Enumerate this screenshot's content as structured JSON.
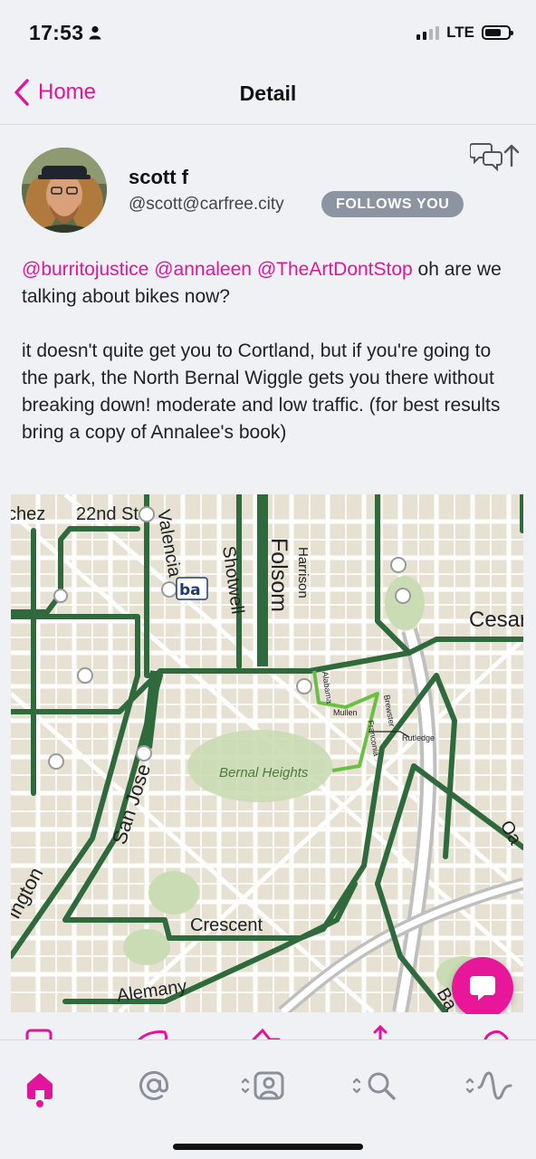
{
  "status": {
    "time": "17:53",
    "network": "LTE"
  },
  "nav": {
    "back_label": "Home",
    "title": "Detail"
  },
  "post": {
    "display_name": "scott f",
    "handle": "@scott@carfree.city",
    "badge": "FOLLOWS YOU",
    "mentions": [
      "@burritojustice",
      "@annaleen",
      "@TheArtDontStop"
    ],
    "line1_rest": " oh are we talking about bikes now?",
    "paragraph2": "it doesn't quite get you to Cortland, but if you're going to the park, the North Bernal Wiggle gets you there without breaking down! moderate and low traffic. (for best results bring a copy of Annalee's book)"
  },
  "map": {
    "labels": {
      "st22": "22nd St",
      "valencia": "Valencia",
      "shotwell": "Shotwell",
      "folsom": "Folsom",
      "harrison": "Harrison",
      "cesar": "Cesar",
      "alabama": "Alabama",
      "mullen": "Mullen",
      "brewster": "Brewster",
      "franconia": "Franconia",
      "rutledge": "Rutledge",
      "bernal": "Bernal Heights",
      "sanjose": "San Jose",
      "crescent": "Crescent",
      "alemany": "Alemany",
      "ington": "ington",
      "chez": "chez",
      "oak": "Oa",
      "bay": "Ba",
      "bart": "ba"
    }
  },
  "icons": {
    "back": "chevron-left-icon",
    "thread": "thread-up-icon",
    "compose": "compose-bubble-icon",
    "tabs": [
      "home-icon",
      "at-mention-icon",
      "profile-switch-icon",
      "search-switch-icon",
      "activity-switch-icon"
    ]
  },
  "colors": {
    "accent": "#e0159b",
    "badge": "#8d94a1",
    "bike_route": "#2f6b3a",
    "wiggle_route": "#6bc044"
  }
}
